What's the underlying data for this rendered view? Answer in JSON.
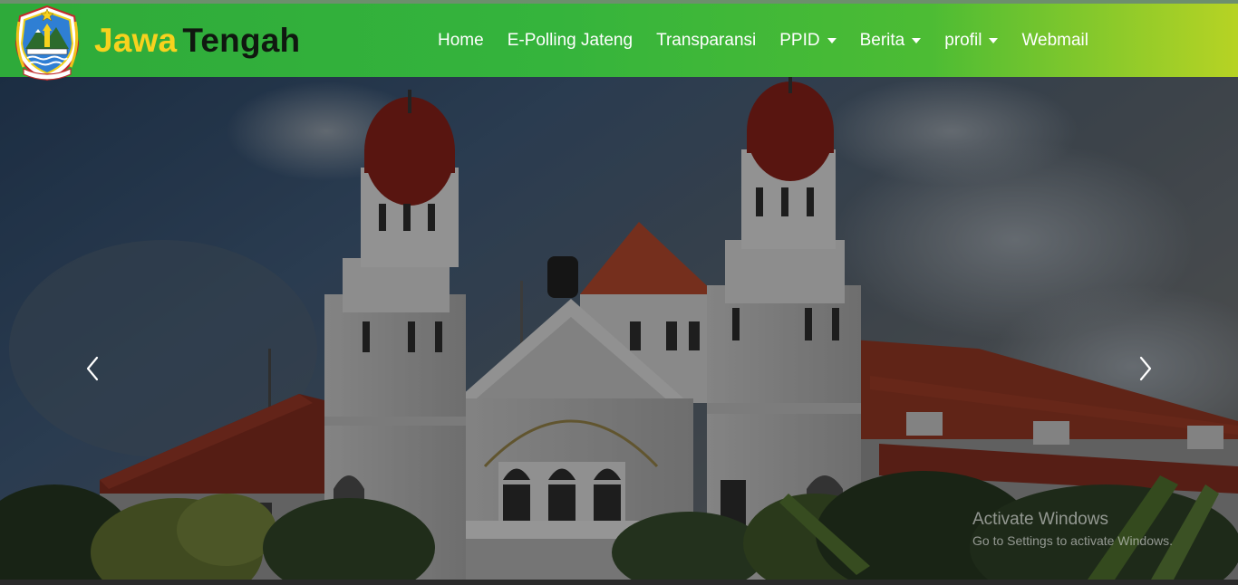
{
  "brand": {
    "part1": "Jawa",
    "part2": "Tengah",
    "colors": {
      "part1": "#f7d21e",
      "part2": "#101810"
    }
  },
  "logo": {
    "icon": "jawa-tengah-crest-icon"
  },
  "nav": {
    "items": [
      {
        "label": "Home",
        "dropdown": false
      },
      {
        "label": "E-Polling Jateng",
        "dropdown": false
      },
      {
        "label": "Transparansi",
        "dropdown": false
      },
      {
        "label": "PPID",
        "dropdown": true
      },
      {
        "label": "Berita",
        "dropdown": true
      },
      {
        "label": "profil",
        "dropdown": true
      },
      {
        "label": "Webmail",
        "dropdown": false
      }
    ]
  },
  "navbar_colors": {
    "start": "#2eaa3a",
    "end": "#b7d324"
  },
  "carousel": {
    "image": "lawang-sewu-building-photo",
    "prev_icon": "chevron-left-icon",
    "next_icon": "chevron-right-icon"
  },
  "watermark": {
    "title": "Activate Windows",
    "subtitle": "Go to Settings to activate Windows."
  }
}
